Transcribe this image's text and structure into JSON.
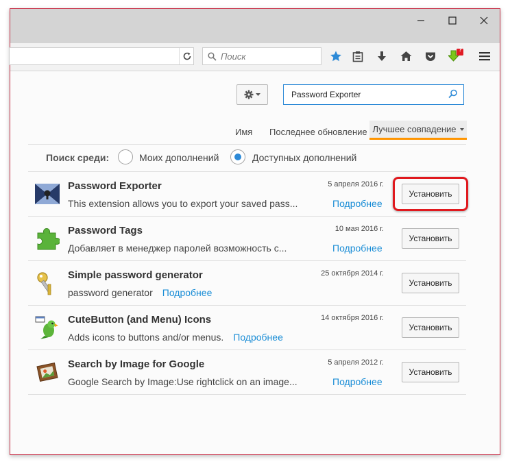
{
  "window": {
    "minimize_icon": "minimize-icon",
    "maximize_icon": "maximize-icon",
    "close_icon": "close-icon"
  },
  "toolbar": {
    "search_placeholder": "Поиск",
    "icons": [
      "reload-icon",
      "star-icon",
      "reading-list-icon",
      "download-icon",
      "home-icon",
      "pocket-icon",
      "download-helper-icon",
      "menu-icon"
    ],
    "badge": "?"
  },
  "addons": {
    "search_value": "Password Exporter",
    "sort": {
      "name": "Имя",
      "last_updated": "Последнее обновление",
      "best_match": "Лучшее совпадение"
    },
    "filter": {
      "label": "Поиск среди:",
      "mine": "Моих дополнений",
      "available": "Доступных дополнений",
      "selected": "available"
    },
    "results": [
      {
        "name": "Password Exporter",
        "description": "This extension allows you to export your saved pass...",
        "more": "Подробнее",
        "date": "5 апреля 2016 г.",
        "install": "Установить",
        "icon": "password-exporter-icon"
      },
      {
        "name": "Password Tags",
        "description": "Добавляет в менеджер паролей возможность с...",
        "more": "Подробнее",
        "date": "10 мая 2016 г.",
        "install": "Установить",
        "icon": "puzzle-piece-icon"
      },
      {
        "name": "Simple password generator",
        "description": "password generator",
        "more": "Подробнее",
        "date": "25 октября 2014 г.",
        "install": "Установить",
        "icon": "keys-icon"
      },
      {
        "name": "CuteButton (and Menu) Icons",
        "description": "Adds icons to buttons and/or menus.",
        "more": "Подробнее",
        "date": "14 октября 2016 г.",
        "install": "Установить",
        "icon": "parrot-icon"
      },
      {
        "name": "Search by Image for Google",
        "description": "Google Search by Image:Use rightclick on an image...",
        "more": "Подробнее",
        "date": "5 апреля 2012 г.",
        "install": "Установить",
        "icon": "picture-frame-icon"
      }
    ]
  },
  "colors": {
    "accent": "#2d8ad7",
    "sort_underline": "#ff9500",
    "highlight": "#e0191e",
    "link": "#1a8dd6"
  }
}
